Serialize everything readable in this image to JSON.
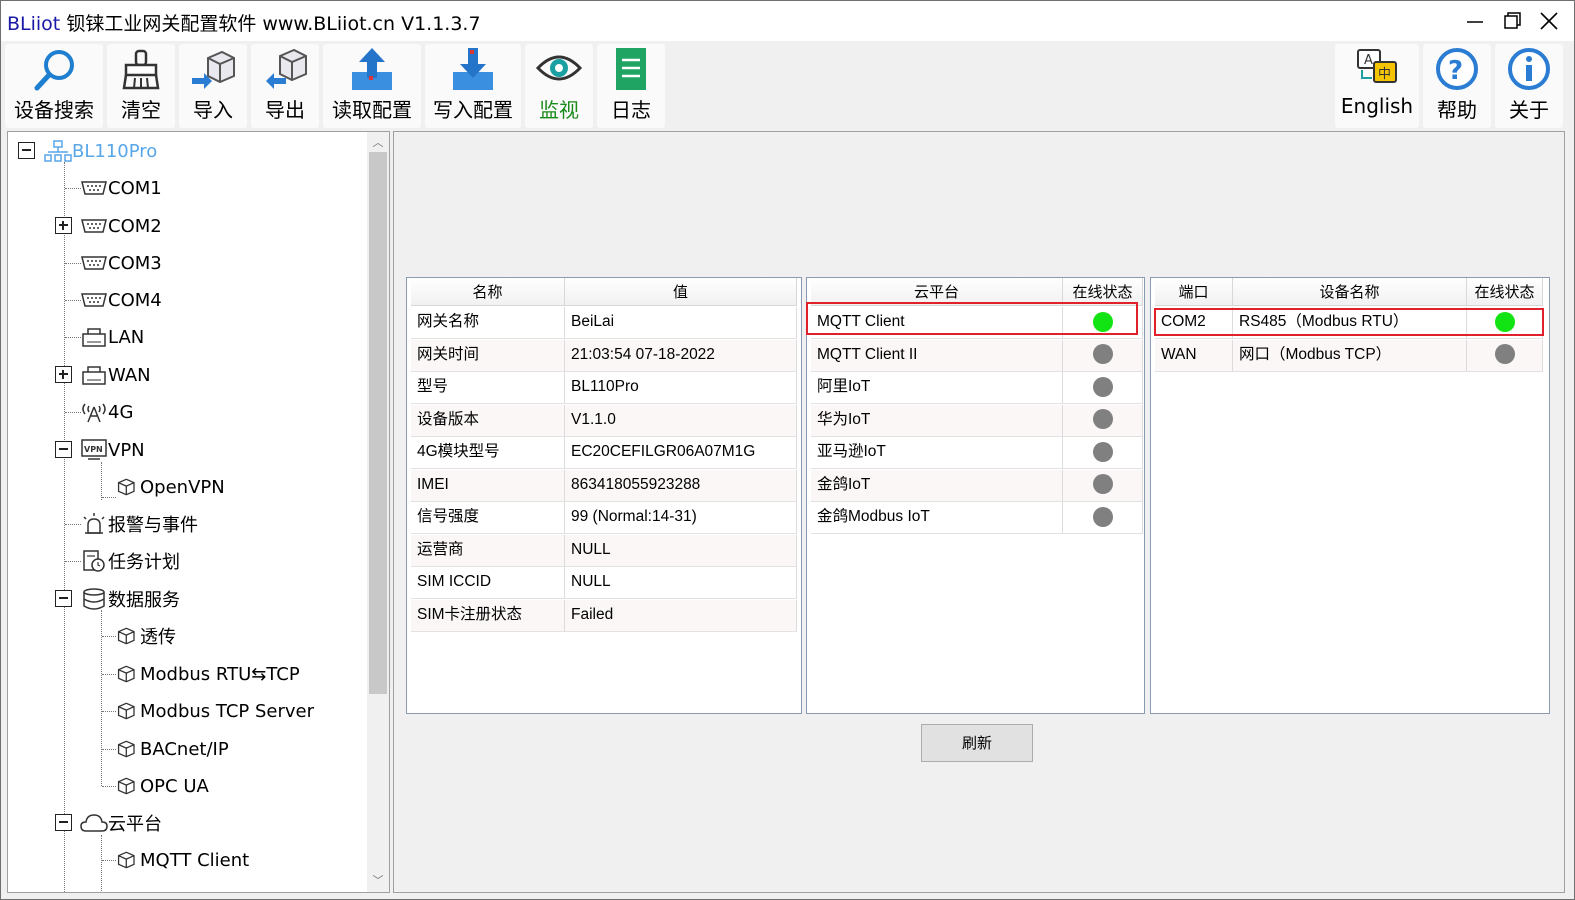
{
  "window": {
    "title_brand": "BLiiot",
    "title_rest": "钡铼工业网关配置软件 www.BLiiot.cn V1.1.3.7"
  },
  "toolbar": {
    "search": "设备搜索",
    "clear": "清空",
    "import": "导入",
    "export": "导出",
    "read_config": "读取配置",
    "write_config": "写入配置",
    "monitor": "监视",
    "log": "日志",
    "english": "English",
    "help": "帮助",
    "about": "关于"
  },
  "tree": {
    "root": "BL110Pro",
    "com1": "COM1",
    "com2": "COM2",
    "com3": "COM3",
    "com4": "COM4",
    "lan": "LAN",
    "wan": "WAN",
    "g4": "4G",
    "vpn": "VPN",
    "openvpn": "OpenVPN",
    "alarm": "报警与事件",
    "task": "任务计划",
    "data_service": "数据服务",
    "transparent": "透传",
    "modbus_rtu_tcp": "Modbus RTU⇆TCP",
    "modbus_tcp_server": "Modbus TCP Server",
    "bacnet": "BACnet/IP",
    "opcua": "OPC UA",
    "cloud": "云平台",
    "mqtt_client": "MQTT Client"
  },
  "info_table": {
    "headers": [
      "名称",
      "值"
    ],
    "rows": [
      [
        "网关名称",
        "BeiLai"
      ],
      [
        "网关时间",
        "21:03:54 07-18-2022"
      ],
      [
        "型号",
        "BL110Pro"
      ],
      [
        "设备版本",
        "V1.1.0"
      ],
      [
        "4G模块型号",
        "EC20CEFILGR06A07M1G"
      ],
      [
        "IMEI",
        "863418055923288"
      ],
      [
        "信号强度",
        "99 (Normal:14-31)"
      ],
      [
        "运营商",
        "NULL"
      ],
      [
        "SIM ICCID",
        "NULL"
      ],
      [
        "SIM卡注册状态",
        "Failed"
      ]
    ]
  },
  "cloud_table": {
    "headers": [
      "云平台",
      "在线状态"
    ],
    "rows": [
      {
        "name": "MQTT Client",
        "online": true
      },
      {
        "name": "MQTT Client II",
        "online": false
      },
      {
        "name": "阿里IoT",
        "online": false
      },
      {
        "name": "华为IoT",
        "online": false
      },
      {
        "name": "亚马逊IoT",
        "online": false
      },
      {
        "name": "金鸽IoT",
        "online": false
      },
      {
        "name": "金鸽Modbus IoT",
        "online": false
      }
    ]
  },
  "port_table": {
    "headers": [
      "端口",
      "设备名称",
      "在线状态"
    ],
    "rows": [
      {
        "port": "COM2",
        "device": "RS485（Modbus RTU）",
        "online": true
      },
      {
        "port": "WAN",
        "device": "网口（Modbus TCP）",
        "online": false
      }
    ]
  },
  "refresh_label": "刷新",
  "colors": {
    "online": "#12e312",
    "offline": "#808080",
    "highlight": "#e0202a",
    "active_tab": "#1a8a1a"
  }
}
